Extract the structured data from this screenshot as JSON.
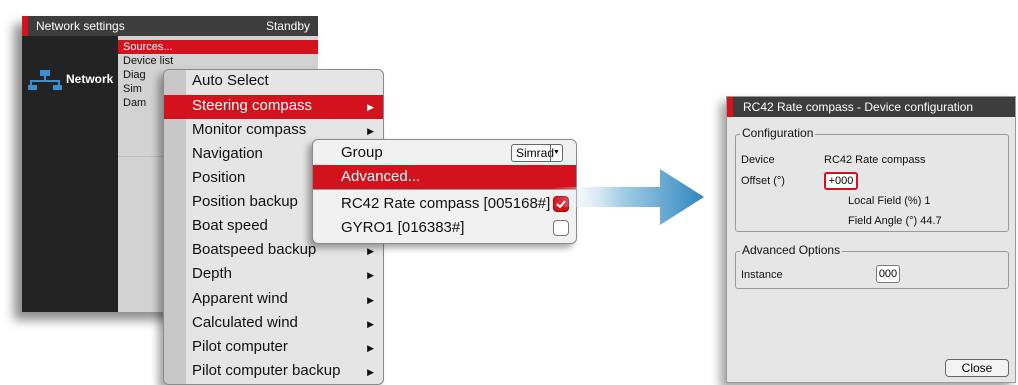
{
  "network_window": {
    "title": "Network settings",
    "status": "Standby",
    "sidebar_label": "Network",
    "items": [
      {
        "label": "Sources...",
        "selected": true
      },
      {
        "label": "Device list"
      },
      {
        "label": "Diag"
      },
      {
        "label": "Sim"
      },
      {
        "label": "Dam"
      }
    ]
  },
  "source_menu": {
    "items": [
      {
        "label": "Auto Select",
        "arrow": ""
      },
      {
        "label": "Steering compass",
        "arrow": "▶",
        "selected": true
      },
      {
        "label": "Monitor compass",
        "arrow": "▶"
      },
      {
        "label": "Navigation",
        "arrow": "▶"
      },
      {
        "label": "Position",
        "arrow": "▶"
      },
      {
        "label": "Position backup",
        "arrow": "▶"
      },
      {
        "label": "Boat speed",
        "arrow": "▶"
      },
      {
        "label": "Boatspeed backup",
        "arrow": "▶"
      },
      {
        "label": "Depth",
        "arrow": "▶"
      },
      {
        "label": "Apparent wind",
        "arrow": "▶"
      },
      {
        "label": "Calculated wind",
        "arrow": "▶"
      },
      {
        "label": "Pilot computer",
        "arrow": "▶"
      },
      {
        "label": "Pilot computer backup",
        "arrow": "▶"
      }
    ]
  },
  "submenu": {
    "group_label": "Group",
    "group_value": "Simrad",
    "advanced_label": "Advanced...",
    "devices": [
      {
        "label": "RC42 Rate compass [005168#]",
        "checked": true
      },
      {
        "label": "GYRO1 [016383#]",
        "checked": false
      }
    ]
  },
  "device_config": {
    "title": "RC42 Rate compass - Device configuration",
    "configuration_legend": "Configuration",
    "device_label": "Device",
    "device_value": "RC42 Rate compass",
    "offset_label": "Offset (°)",
    "offset_value": "+000",
    "local_field": "Local Field (%) 1",
    "field_angle": "Field Angle (°) 44.7",
    "advanced_legend": "Advanced Options",
    "instance_label": "Instance",
    "instance_value": "000",
    "close_label": "Close"
  },
  "colors": {
    "accent": "#d4121d",
    "title_bar": "#3d3d3d",
    "arrow": "#3a90c2"
  }
}
